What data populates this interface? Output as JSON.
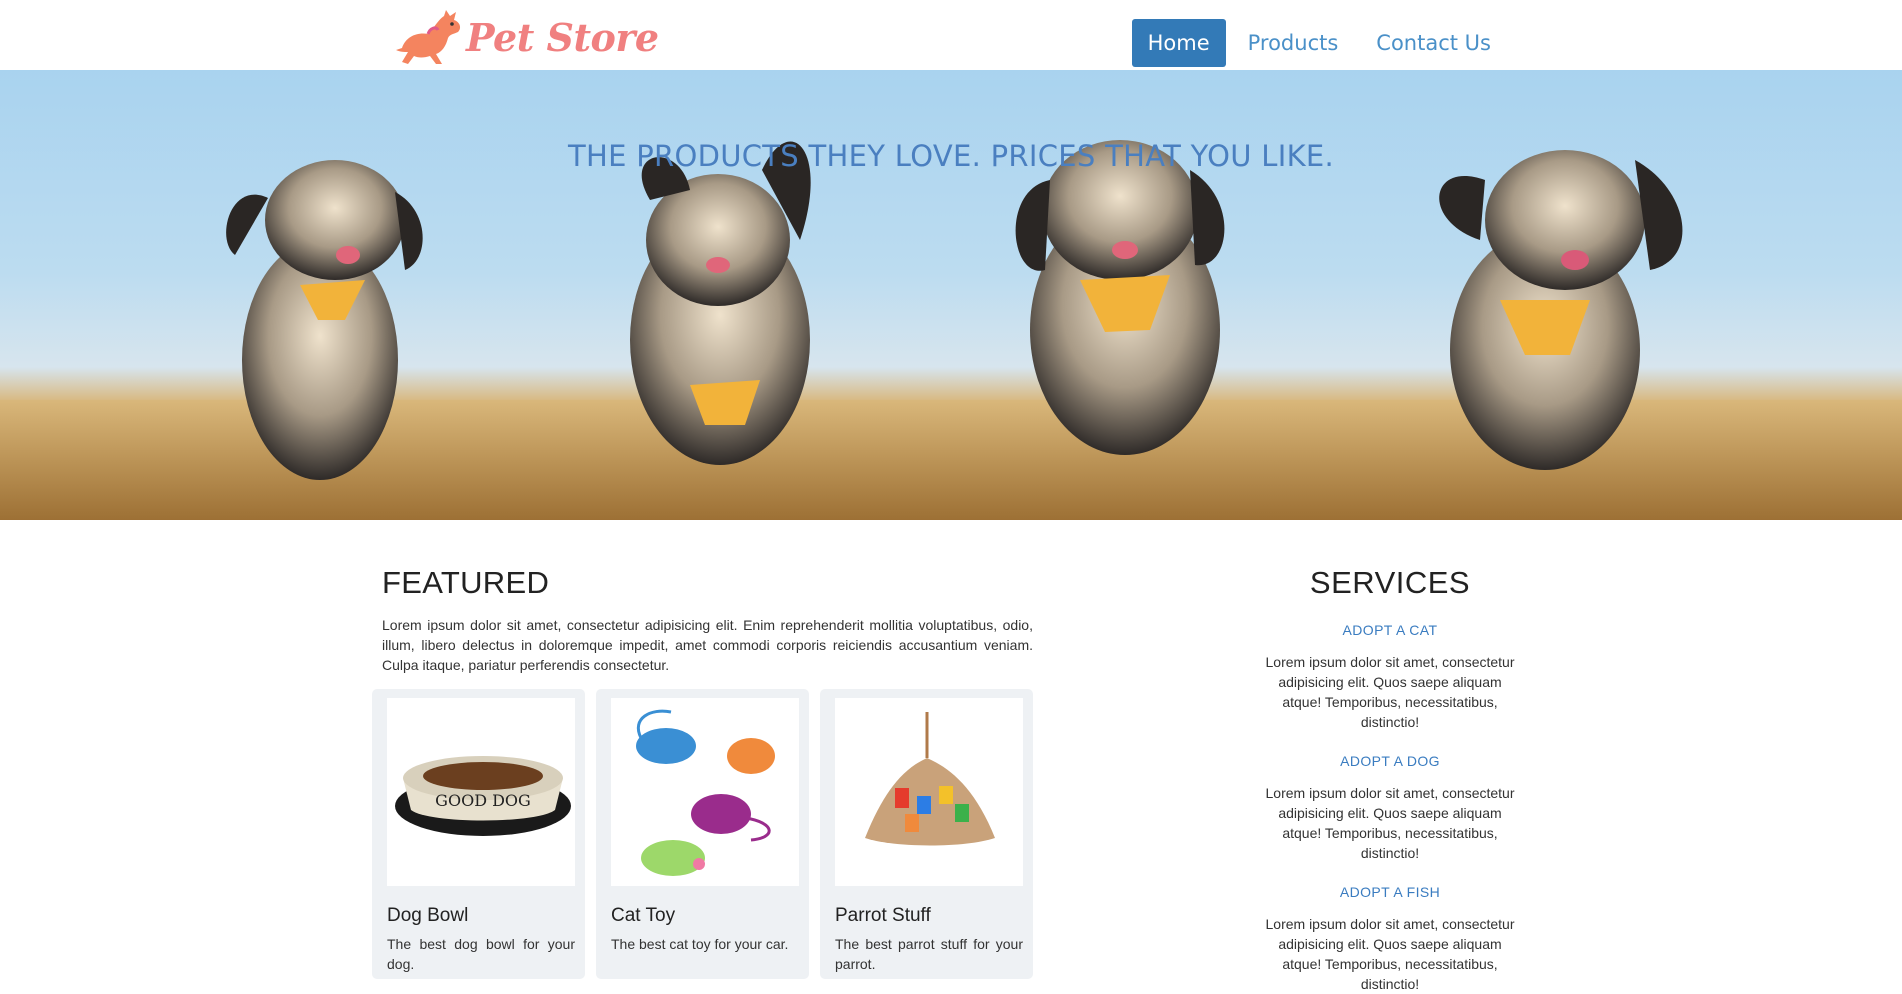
{
  "brand": {
    "name": "Pet Store",
    "logo_icon": "running-dog-icon",
    "color": "#f08080"
  },
  "nav": {
    "items": [
      {
        "label": "Home",
        "active": true
      },
      {
        "label": "Products",
        "active": false
      },
      {
        "label": "Contact Us",
        "active": false
      }
    ],
    "accent": "#337ab7"
  },
  "hero": {
    "title": "THE PRODUCTS THEY LOVE. PRICES THAT YOU LIKE.",
    "image": "four-running-dogs-in-field"
  },
  "featured": {
    "heading": "FEATURED",
    "intro": "Lorem ipsum dolor sit amet, consectetur adipisicing elit. Enim reprehenderit mollitia voluptatibus, odio, illum, libero delectus in doloremque impedit, amet commodi corporis reiciendis accusantium veniam. Culpa itaque, pariatur perferendis consectetur.",
    "products": [
      {
        "name": "Dog Bowl",
        "description": "The best dog bowl for your dog.",
        "image": "dog-bowl-image",
        "bowl_text": "GOOD DOG"
      },
      {
        "name": "Cat Toy",
        "description": "The best cat toy for your car.",
        "image": "cat-toy-mice-image"
      },
      {
        "name": "Parrot Stuff",
        "description": "The best parrot stuff for your parrot.",
        "image": "parrot-toy-image"
      }
    ]
  },
  "services": {
    "heading": "SERVICES",
    "items": [
      {
        "title": "ADOPT A CAT",
        "body": "Lorem ipsum dolor sit amet, consectetur adipisicing elit. Quos saepe aliquam atque! Temporibus, necessitatibus, distinctio!"
      },
      {
        "title": "ADOPT A DOG",
        "body": "Lorem ipsum dolor sit amet, consectetur adipisicing elit. Quos saepe aliquam atque! Temporibus, necessitatibus, distinctio!"
      },
      {
        "title": "ADOPT A FISH",
        "body": "Lorem ipsum dolor sit amet, consectetur adipisicing elit. Quos saepe aliquam atque! Temporibus, necessitatibus, distinctio!"
      }
    ]
  }
}
